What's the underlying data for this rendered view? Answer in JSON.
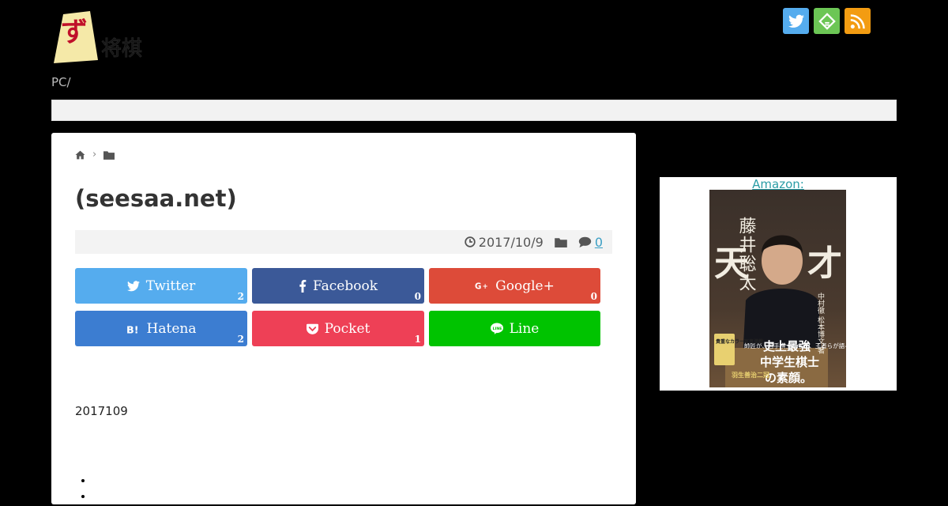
{
  "header": {
    "tagline": "PC/",
    "social": [
      {
        "name": "twitter-icon",
        "color": "#55acee"
      },
      {
        "name": "feedly-icon",
        "color": "#6cc655"
      },
      {
        "name": "rss-icon",
        "color": "#f39c12"
      }
    ]
  },
  "article": {
    "title": "(seesaa.net)",
    "date": "2017/10/9",
    "comments": "0",
    "share": [
      {
        "label": "Twitter",
        "count": "2",
        "color": "#55acee",
        "icon": "twitter-icon"
      },
      {
        "label": "Facebook",
        "count": "0",
        "color": "#3b5998",
        "icon": "facebook-icon"
      },
      {
        "label": "Google+",
        "count": "0",
        "color": "#dd4b39",
        "icon": "google-plus-icon"
      },
      {
        "label": "Hatena",
        "count": "2",
        "color": "#3c7dd1",
        "icon": "hatena-icon"
      },
      {
        "label": "Pocket",
        "count": "1",
        "color": "#ee4056",
        "icon": "pocket-icon"
      },
      {
        "label": "Line",
        "count": "",
        "color": "#00c300",
        "icon": "line-icon"
      }
    ],
    "body_date": "2017109"
  },
  "sidebar": {
    "amazon_link": "Amazon:",
    "book": {
      "title_right": "才",
      "title_left": "天",
      "author_vertical": "藤井聡太",
      "subtitle": "史上最強",
      "subtitle2": "中学生棋士",
      "subtitle3": "の素顔。",
      "blurb": "師匠が、若手棋士たちが、王者らが語る",
      "editors": "中村徹 松本博文 著",
      "badge": "貴重なカラー写真満載",
      "band": "羽生善治二冠"
    }
  }
}
